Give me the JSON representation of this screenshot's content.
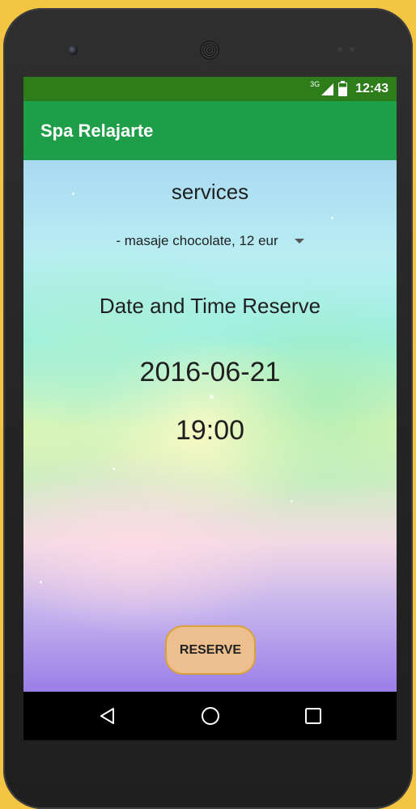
{
  "status_bar": {
    "network_type": "3G",
    "time": "12:43"
  },
  "app_bar": {
    "title": "Spa Relajarte"
  },
  "form": {
    "services_label": "services",
    "service_selected": "- masaje chocolate, 12 eur",
    "date_time_label": "Date and Time Reserve",
    "date_value": "2016-06-21",
    "time_value": "19:00",
    "reserve_button": "RESERVE"
  },
  "nav_bar": {
    "icons": [
      "back-icon",
      "home-icon",
      "recents-icon"
    ]
  },
  "colors": {
    "status_bar": "#2e7d1b",
    "app_bar": "#1e9e48",
    "button_fill": "#edbf8e",
    "button_border": "#d9a236"
  }
}
